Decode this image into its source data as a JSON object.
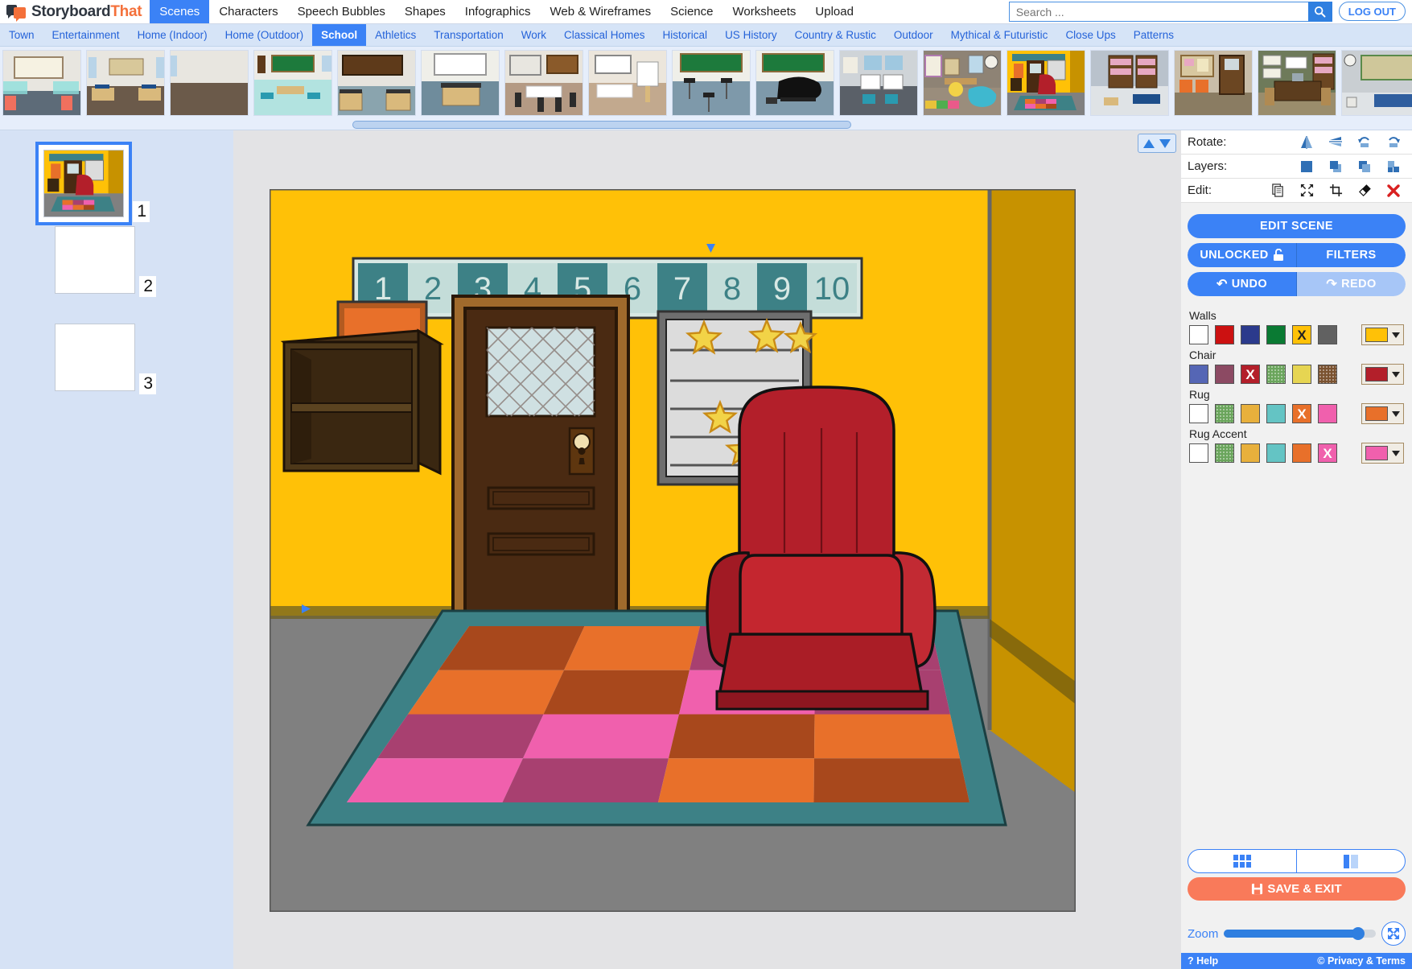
{
  "brand": {
    "name_part1": "Storyboard",
    "name_part2": "That"
  },
  "topnav": {
    "items": [
      {
        "label": "Scenes",
        "active": true
      },
      {
        "label": "Characters",
        "active": false
      },
      {
        "label": "Speech Bubbles",
        "active": false
      },
      {
        "label": "Shapes",
        "active": false
      },
      {
        "label": "Infographics",
        "active": false
      },
      {
        "label": "Web & Wireframes",
        "active": false
      },
      {
        "label": "Science",
        "active": false
      },
      {
        "label": "Worksheets",
        "active": false
      },
      {
        "label": "Upload",
        "active": false
      }
    ],
    "search_placeholder": "Search ...",
    "search_value": "",
    "search_icon": "search-icon",
    "logout_label": "LOG OUT"
  },
  "subnav": {
    "items": [
      {
        "label": "Town",
        "active": false
      },
      {
        "label": "Entertainment",
        "active": false
      },
      {
        "label": "Home (Indoor)",
        "active": false
      },
      {
        "label": "Home (Outdoor)",
        "active": false
      },
      {
        "label": "School",
        "active": true
      },
      {
        "label": "Athletics",
        "active": false
      },
      {
        "label": "Transportation",
        "active": false
      },
      {
        "label": "Work",
        "active": false
      },
      {
        "label": "Classical Homes",
        "active": false
      },
      {
        "label": "Historical",
        "active": false
      },
      {
        "label": "US History",
        "active": false
      },
      {
        "label": "Country & Rustic",
        "active": false
      },
      {
        "label": "Outdoor",
        "active": false
      },
      {
        "label": "Mythical & Futuristic",
        "active": false
      },
      {
        "label": "Close Ups",
        "active": false
      },
      {
        "label": "Patterns",
        "active": false
      }
    ]
  },
  "scene_strip": {
    "scenes": [
      {
        "name": "classroom-whiteboard-desks"
      },
      {
        "name": "classroom-rows-of-desks"
      },
      {
        "name": "empty-room-wood-floor"
      },
      {
        "name": "classroom-green-chalkboard"
      },
      {
        "name": "science-lab-counters"
      },
      {
        "name": "lab-whiteboard-island"
      },
      {
        "name": "art-room-stools"
      },
      {
        "name": "classroom-easel"
      },
      {
        "name": "music-room-stands"
      },
      {
        "name": "music-room-piano"
      },
      {
        "name": "computer-lab"
      },
      {
        "name": "preschool-playroom"
      },
      {
        "name": "school-entry-yellow-walls"
      },
      {
        "name": "library-bookshelves"
      },
      {
        "name": "principal-office-hall"
      },
      {
        "name": "office-desk-bookshelf"
      },
      {
        "name": "nurse-office"
      }
    ],
    "scrollbar": "horizontal-scrollbar"
  },
  "cells": [
    {
      "number": "1",
      "selected": true,
      "preview": "school-entry-yellow-walls"
    },
    {
      "number": "2",
      "selected": false,
      "preview": "blank"
    },
    {
      "number": "3",
      "selected": false,
      "preview": "blank"
    }
  ],
  "canvas": {
    "pager_up": "▲",
    "pager_down": "▼",
    "selection_handles": [
      "top",
      "bottom",
      "left",
      "right"
    ]
  },
  "right_panel": {
    "rows": [
      {
        "label": "Rotate:",
        "icons": [
          "flip-horizontal-icon",
          "flip-vertical-icon",
          "rotate-left-icon",
          "rotate-right-icon"
        ]
      },
      {
        "label": "Layers:",
        "icons": [
          "bring-to-front-icon",
          "bring-forward-icon",
          "send-backward-icon",
          "send-to-back-icon"
        ]
      },
      {
        "label": "Edit:",
        "icons": [
          "copy-icon",
          "resize-icon",
          "crop-icon",
          "eraser-icon",
          "delete-icon"
        ]
      }
    ],
    "edit_scene_label": "EDIT SCENE",
    "unlocked_label": "UNLOCKED",
    "unlocked_icon": "unlock-icon",
    "filters_label": "FILTERS",
    "undo_label": "UNDO",
    "undo_icon": "undo-icon",
    "redo_label": "REDO",
    "redo_icon": "redo-icon",
    "redo_disabled": true,
    "color_groups": [
      {
        "name": "Walls",
        "swatches": [
          {
            "color": "#ffffff",
            "selected": false,
            "pattern": "solid"
          },
          {
            "color": "#cc1111",
            "selected": false,
            "pattern": "solid"
          },
          {
            "color": "#2b3a8c",
            "selected": false,
            "pattern": "solid"
          },
          {
            "color": "#0a7a33",
            "selected": false,
            "pattern": "solid"
          },
          {
            "color": "#ffc107",
            "selected": true,
            "pattern": "solid",
            "x_color": "#222222"
          },
          {
            "color": "#616161",
            "selected": false,
            "pattern": "solid"
          }
        ],
        "current": "#ffc107"
      },
      {
        "name": "Chair",
        "swatches": [
          {
            "color": "#5566b5",
            "selected": false,
            "pattern": "solid"
          },
          {
            "color": "#8c4a63",
            "selected": false,
            "pattern": "solid"
          },
          {
            "color": "#b31f2a",
            "selected": true,
            "pattern": "solid",
            "x_color": "#ffffff"
          },
          {
            "color": "#6aa55c",
            "selected": false,
            "pattern": "dotted"
          },
          {
            "color": "#e6d552",
            "selected": false,
            "pattern": "solid"
          },
          {
            "color": "#7a5230",
            "selected": false,
            "pattern": "dotted"
          }
        ],
        "current": "#b31f2a"
      },
      {
        "name": "Rug",
        "swatches": [
          {
            "color": "#ffffff",
            "selected": false,
            "pattern": "solid"
          },
          {
            "color": "#6aa55c",
            "selected": false,
            "pattern": "dotted"
          },
          {
            "color": "#e8b03c",
            "selected": false,
            "pattern": "solid"
          },
          {
            "color": "#64c4c4",
            "selected": false,
            "pattern": "solid"
          },
          {
            "color": "#e8702a",
            "selected": true,
            "pattern": "solid",
            "x_color": "#ffffff"
          },
          {
            "color": "#f060ad",
            "selected": false,
            "pattern": "solid"
          }
        ],
        "current": "#e8702a"
      },
      {
        "name": "Rug Accent",
        "swatches": [
          {
            "color": "#ffffff",
            "selected": false,
            "pattern": "solid"
          },
          {
            "color": "#6aa55c",
            "selected": false,
            "pattern": "dotted"
          },
          {
            "color": "#e8b03c",
            "selected": false,
            "pattern": "solid"
          },
          {
            "color": "#64c4c4",
            "selected": false,
            "pattern": "solid"
          },
          {
            "color": "#e8702a",
            "selected": false,
            "pattern": "solid"
          },
          {
            "color": "#f060ad",
            "selected": true,
            "pattern": "solid",
            "x_color": "#ffffff"
          }
        ],
        "current": "#f060ad"
      }
    ],
    "view_grid_icon": "grid-view-icon",
    "view_columns_icon": "column-view-icon",
    "save_exit_label": "SAVE & EXIT",
    "save_icon": "save-disk-icon",
    "zoom_label": "Zoom",
    "zoom_percent": 88,
    "fit_icon": "fit-to-screen-icon"
  },
  "bottom_bar": {
    "help_label": "Help",
    "help_icon": "question-icon",
    "privacy_label": "Privacy & Terms",
    "privacy_icon": "copyright-icon"
  },
  "scene_content": {
    "number_strip": [
      "1",
      "2",
      "3",
      "4",
      "5",
      "6",
      "7",
      "8",
      "9",
      "10"
    ],
    "number_strip_dark": "#3d8186",
    "number_strip_light": "#c4ddd9",
    "wall_color": "#ffc107",
    "wall_side_color": "#c79200",
    "floor_color": "#808080",
    "chair_color": "#b31f2a",
    "rug_border_color": "#3d8186",
    "rug_tiles": [
      [
        "#a8481c",
        "#e8702a",
        "#a84070",
        "#a84070"
      ],
      [
        "#e8702a",
        "#a8481c",
        "#f060ad",
        "#a84070"
      ],
      [
        "#a84070",
        "#f060ad",
        "#a8481c",
        "#e8702a"
      ],
      [
        "#f060ad",
        "#a84070",
        "#e8702a",
        "#a8481c"
      ]
    ],
    "poster_star_count": 6,
    "door_color": "#4a2a12",
    "picture_frame_color": "#e8702a"
  }
}
